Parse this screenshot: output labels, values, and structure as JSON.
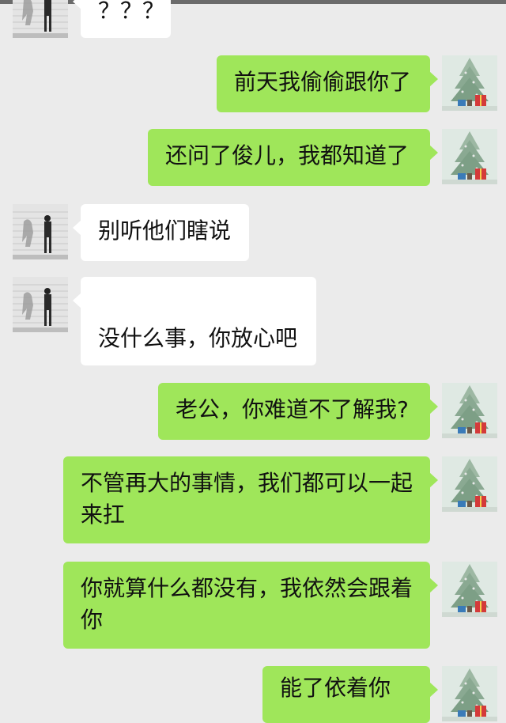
{
  "chat": {
    "messages": [
      {
        "side": "left",
        "text": "？？？"
      },
      {
        "side": "right",
        "text": "前天我偷偷跟你了"
      },
      {
        "side": "right",
        "text": "还问了俊儿，我都知道了"
      },
      {
        "side": "left",
        "text": "别听他们瞎说"
      },
      {
        "side": "left",
        "text": "没什么事，你放心吧"
      },
      {
        "side": "right",
        "text": "老公，你难道不了解我?"
      },
      {
        "side": "right",
        "text": "不管再大的事情，我们都可以一起来扛"
      },
      {
        "side": "right",
        "text": "你就算什么都没有，我依然会跟着你"
      },
      {
        "side": "right",
        "text": "能了依着你"
      }
    ]
  },
  "colors": {
    "background": "#ebebeb",
    "incoming_bubble": "#ffffff",
    "outgoing_bubble": "#9fe65a"
  },
  "icons": {
    "incoming_avatar": "shadow-walker-avatar",
    "outgoing_avatar": "christmas-tree-avatar"
  }
}
